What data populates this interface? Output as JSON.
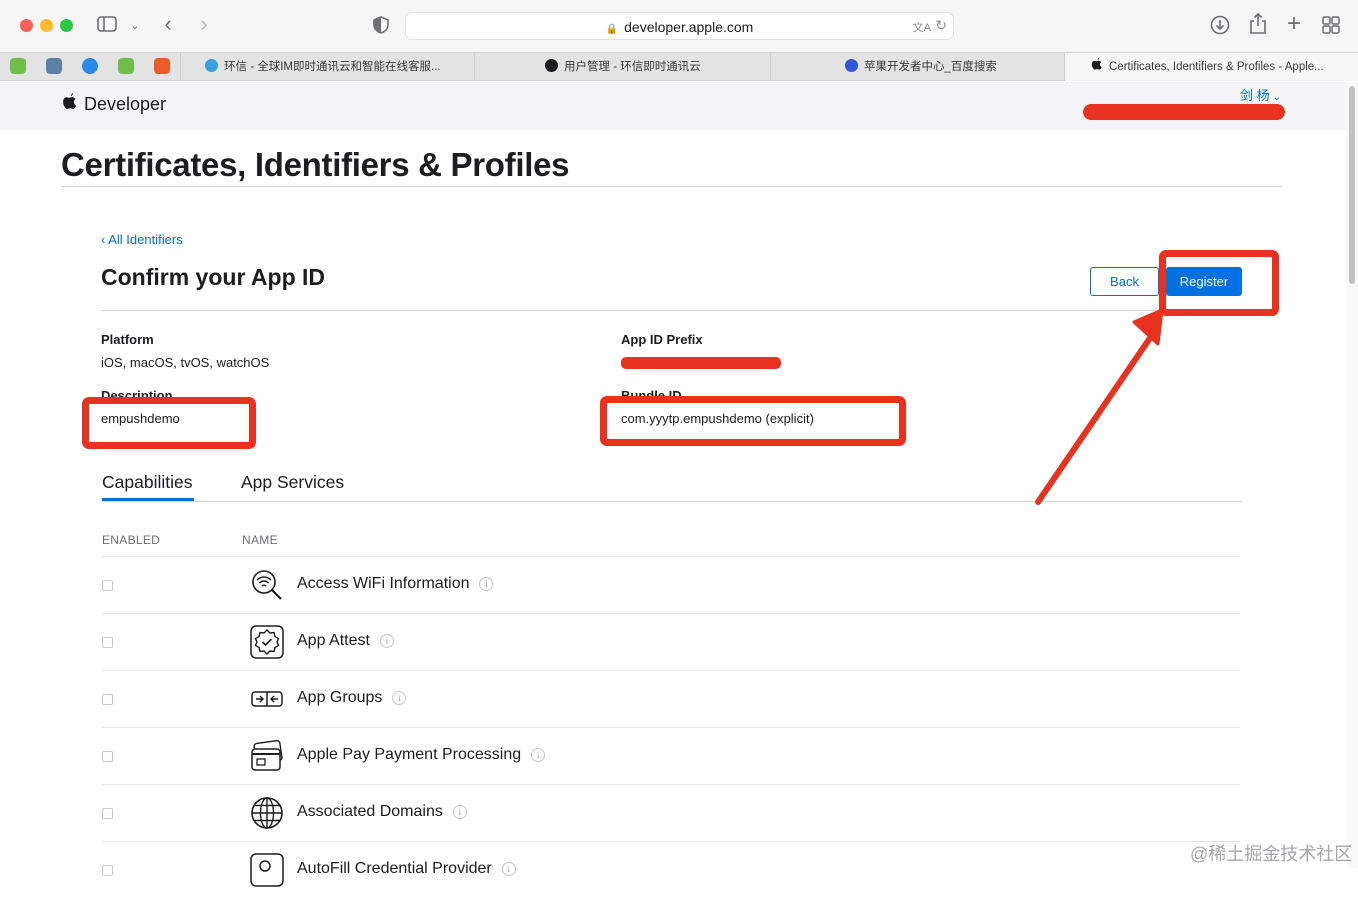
{
  "browser": {
    "url": "developer.apple.com",
    "tabs": [
      {
        "label": "环信 - 全球IM即时通讯云和智能在线客服..."
      },
      {
        "label": "用户管理 - 环信即时通讯云"
      },
      {
        "label": "苹果开发者中心_百度搜索"
      },
      {
        "label": "Certificates, Identifiers & Profiles - Apple..."
      }
    ]
  },
  "header": {
    "brand": "Developer",
    "user": "剑 杨"
  },
  "page": {
    "title": "Certificates, Identifiers & Profiles",
    "back_link": "‹ All Identifiers",
    "heading": "Confirm your App ID",
    "back_button": "Back",
    "register_button": "Register"
  },
  "fields": {
    "platform_label": "Platform",
    "platform_value": "iOS, macOS, tvOS, watchOS",
    "app_id_prefix_label": "App ID Prefix",
    "description_label": "Description",
    "description_value": "empushdemo",
    "bundle_id_label": "Bundle ID",
    "bundle_id_value": "com.yyytp.empushdemo (explicit)"
  },
  "tabs": {
    "capabilities": "Capabilities",
    "app_services": "App Services"
  },
  "table": {
    "col_enabled": "ENABLED",
    "col_name": "NAME",
    "rows": [
      {
        "name": "Access WiFi Information",
        "icon": "wifi-search-icon",
        "enabled": false
      },
      {
        "name": "App Attest",
        "icon": "badge-check-icon",
        "enabled": false
      },
      {
        "name": "App Groups",
        "icon": "app-groups-icon",
        "enabled": false
      },
      {
        "name": "Apple Pay Payment Processing",
        "icon": "credit-card-icon",
        "enabled": false
      },
      {
        "name": "Associated Domains",
        "icon": "globe-icon",
        "enabled": false
      },
      {
        "name": "AutoFill Credential Provider",
        "icon": "autofill-icon",
        "enabled": false
      }
    ]
  },
  "watermark": "@稀土掘金技术社区",
  "colors": {
    "accent": "#0071e3",
    "annotation": "#e8321f"
  }
}
